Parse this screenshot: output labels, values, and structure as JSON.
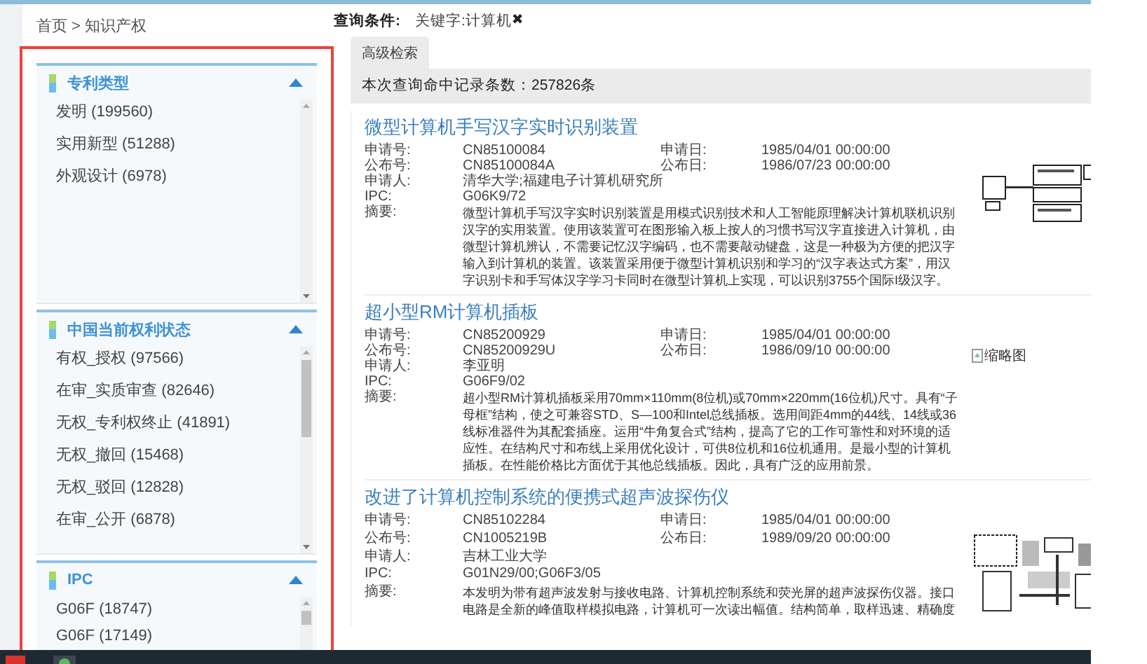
{
  "breadcrumb": "首页 > 知识产权",
  "query": {
    "label": "查询条件:",
    "chip": "关键字:计算机",
    "remove": "✖"
  },
  "tabs": [
    {
      "label": "高级检索",
      "selected": true
    }
  ],
  "hit_count": "本次查询命中记录条数：257826条",
  "facets": [
    {
      "title": "专利类型",
      "expanded": true,
      "items": [
        "发明 (199560)",
        "实用新型 (51288)",
        "外观设计 (6978)"
      ]
    },
    {
      "title": "中国当前权利状态",
      "expanded": true,
      "items": [
        "有权_授权 (97566)",
        "在审_实质审查 (82646)",
        "无权_专利权终止 (41891)",
        "无权_撤回 (15468)",
        "无权_驳回 (12828)",
        "在审_公开 (6878)"
      ]
    },
    {
      "title": "IPC",
      "expanded": true,
      "items": [
        "G06F (18747)",
        "G06F (17149)"
      ]
    }
  ],
  "results": [
    {
      "title": "微型计算机手写汉字实时识别装置",
      "rows": [
        [
          {
            "label": "申请号:",
            "value": "CN85100084"
          },
          {
            "label": "申请日:",
            "value": "1985/04/01 00:00:00"
          }
        ],
        [
          {
            "label": "公布号:",
            "value": "CN85100084A"
          },
          {
            "label": "公布日:",
            "value": "1986/07/23 00:00:00"
          }
        ],
        [
          {
            "label": "申请人:",
            "value": "清华大学;福建电子计算机研究所"
          }
        ],
        [
          {
            "label": "IPC:",
            "value": "G06K9/72"
          }
        ],
        [
          {
            "label": "摘要:",
            "value": "微型计算机手写汉字实时识别装置是用模式识别技术和人工智能原理解决计算机联机识别汉字的实用装置。使用该装置可在图形输入板上按人的习惯书写汉字直接进入计算机，由微型计算机辨认，不需要记忆汉字编码，也不需要敲动键盘，这是一种极为方便的把汉字输入到计算机的装置。该装置采用便于微型计算机识别和学习的“汉字表达式方案”，用汉字识别卡和手写体汉字学习卡同时在微型计算机上实现，可以识别3755个国际I级汉字。"
          }
        ]
      ],
      "thumbnail": {
        "kind": "diagram"
      }
    },
    {
      "title": "超小型RM计算机插板",
      "rows": [
        [
          {
            "label": "申请号:",
            "value": "CN85200929"
          },
          {
            "label": "申请日:",
            "value": "1985/04/01 00:00:00"
          }
        ],
        [
          {
            "label": "公布号:",
            "value": "CN85200929U"
          },
          {
            "label": "公布日:",
            "value": "1986/09/10 00:00:00"
          }
        ],
        [
          {
            "label": "申请人:",
            "value": "李亚明"
          }
        ],
        [
          {
            "label": "IPC:",
            "value": "G06F9/02"
          }
        ],
        [
          {
            "label": "摘要:",
            "value": "超小型RM计算机插板采用70mm×110mm(8位机)或70mm×220mm(16位机)尺寸。具有“子母框”结构，使之可兼容STD、S—100和Intel总线插板。选用间距4mm的44线、14线或36线标准器件为其配套插座。运用“牛角复合式”结构，提高了它的工作可靠性和对环境的适应性。在结构尺寸和布线上采用优化设计，可供8位机和16位机通用。是最小型的计算机插板。在性能价格比方面优于其他总线插板。因此，具有广泛的应用前景。"
          }
        ]
      ],
      "thumbnail": {
        "kind": "broken",
        "alt": "缩略图"
      }
    },
    {
      "title": "改进了计算机控制系统的便携式超声波探伤仪",
      "rows": [
        [
          {
            "label": "申请号:",
            "value": "CN85102284"
          },
          {
            "label": "申请日:",
            "value": "1985/04/01 00:00:00"
          }
        ],
        [
          {
            "label": "公布号:",
            "value": "CN1005219B"
          },
          {
            "label": "公布日:",
            "value": "1989/09/20 00:00:00"
          }
        ],
        [
          {
            "label": "申请人:",
            "value": "吉林工业大学"
          }
        ],
        [
          {
            "label": "IPC:",
            "value": "G01N29/00;G06F3/05"
          }
        ],
        [
          {
            "label": "摘要:",
            "value": "本发明为带有超声波发射与接收电路、计算机控制系统和荧光屏的超声波探伤仪器。接口电路是全新的峰值取样模拟电路，计算机可一次读出幅值。结构简单，取样迅速、精确度"
          }
        ]
      ],
      "thumbnail": {
        "kind": "circuit"
      }
    }
  ]
}
